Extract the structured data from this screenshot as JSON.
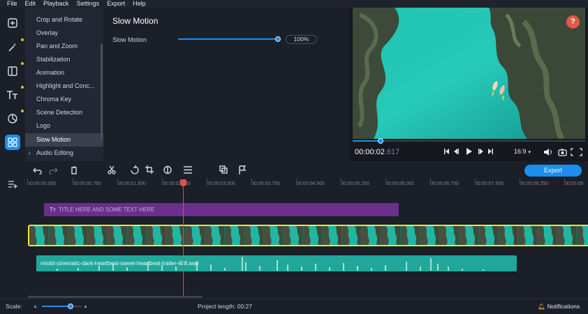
{
  "menu": [
    "File",
    "Edit",
    "Playback",
    "Settings",
    "Export",
    "Help"
  ],
  "tools": [
    {
      "name": "import-icon",
      "badge": false
    },
    {
      "name": "magic-wand-icon",
      "badge": true
    },
    {
      "name": "transitions-icon",
      "badge": true
    },
    {
      "name": "titles-icon",
      "badge": true
    },
    {
      "name": "stickers-icon",
      "badge": true
    },
    {
      "name": "more-tools-icon",
      "badge": false,
      "active": true
    }
  ],
  "filters": {
    "items": [
      "Crop and Rotate",
      "Overlay",
      "Pan and Zoom",
      "Stabilization",
      "Animation",
      "Highlight and Conc...",
      "Chroma Key",
      "Scene Detection",
      "Logo",
      "Slow Motion",
      "Audio Editing"
    ],
    "selected_index": 9
  },
  "settings": {
    "title": "Slow Motion",
    "slider_label": "Slow Motion",
    "slider_value": "100%",
    "slider_fraction": 1.0
  },
  "player": {
    "help": "?",
    "time_main": "00:00:02",
    "time_ms": ".617",
    "aspect": "16:9",
    "progress_fraction": 0.12
  },
  "timeline": {
    "export_label": "Export",
    "ruler": [
      "00:00:00.000",
      "00:00:00.750",
      "00:00:01.500",
      "00:00:02.250",
      "00:00:03.000",
      "00:00:03.750",
      "00:00:04.500",
      "00:00:05.250",
      "00:00:06.000",
      "00:00:06.750",
      "00:00:07.500",
      "00:00:08.250",
      "00:00:09"
    ],
    "title_clip": "TITLE HERE AND SOME TEXT HERE",
    "audio_clip": "mixkit-cinematic-dark-heartbeat-sweet-heartbeat-trailer-488.wav",
    "playhead_time_fraction": 0.2906
  },
  "status": {
    "scale_label": "Scale:",
    "project_length_label": "Project length:",
    "project_length": "00:27",
    "notifications": "Notifications",
    "scale_fraction": 0.6
  },
  "colors": {
    "accent": "#1d8ef0",
    "title_clip": "#6a2f8c",
    "audio_clip": "#1fa89a",
    "playhead": "#e34d4d",
    "selection": "#f5e23a"
  }
}
